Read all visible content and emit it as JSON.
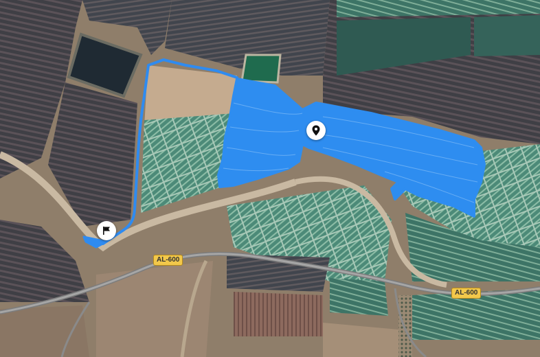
{
  "map": {
    "road_labels": [
      {
        "id": "road-label-al600-west",
        "text": "AL-600"
      },
      {
        "id": "road-label-al600-east",
        "text": "AL-600"
      }
    ],
    "markers": [
      {
        "id": "start-marker",
        "icon": "flag-icon"
      },
      {
        "id": "field-marker",
        "icon": "location-pin-icon"
      }
    ],
    "colors": {
      "track": "#2f8bf0",
      "coverage": "#2a8cf0",
      "road_label_bg": "#f2c84b"
    }
  }
}
